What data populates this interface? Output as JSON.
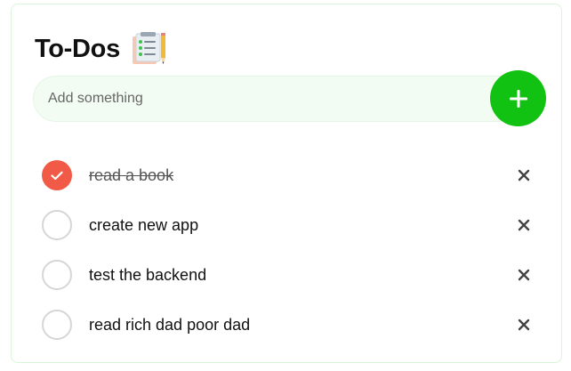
{
  "header": {
    "title": "To-Dos",
    "icon": "checklist-notepad-icon"
  },
  "input": {
    "value": "",
    "placeholder": "Add something"
  },
  "add_button": {
    "icon": "plus-icon",
    "color": "#12c213"
  },
  "todos": [
    {
      "text": "read a book",
      "completed": true
    },
    {
      "text": "create new app",
      "completed": false
    },
    {
      "text": "test the backend",
      "completed": false
    },
    {
      "text": "read rich dad poor dad",
      "completed": false
    }
  ],
  "colors": {
    "completed_check": "#f25a48",
    "input_background": "#f3fcf2",
    "card_border": "#d9f5d9"
  }
}
